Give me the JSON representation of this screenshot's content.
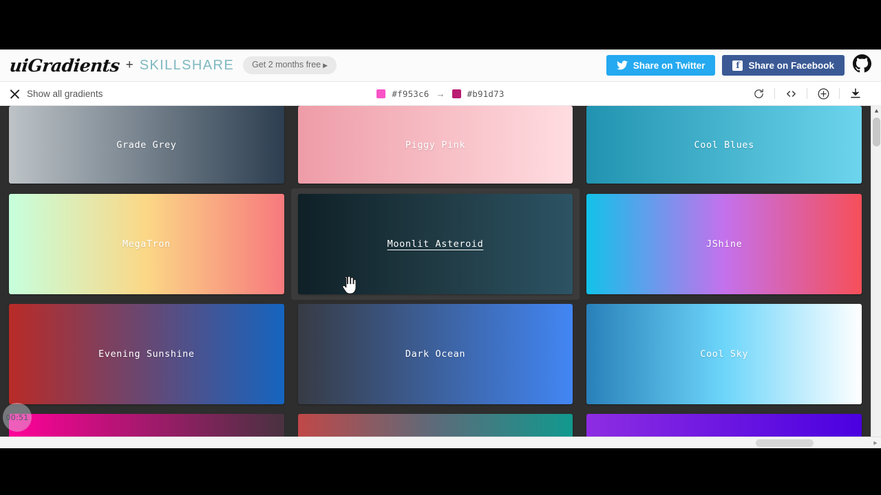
{
  "header": {
    "logo_primary": "uiGradients",
    "logo_plus": "+",
    "logo_partner": "SKILLSHARE",
    "promo_label": "Get 2 months free",
    "promo_caret": "▶",
    "share_twitter_label": "Share on Twitter",
    "share_facebook_label": "Share on Facebook",
    "facebook_glyph": "f",
    "twitter_icon": "twitter-bird-icon",
    "github_icon": "github-octocat-icon",
    "twitter_color": "#25a9f0",
    "facebook_color": "#3b5a95",
    "partner_color": "#7fb8c0"
  },
  "subheader": {
    "show_all_label": "Show all gradients",
    "close_icon": "close-x-icon",
    "color_start": "#f953c6",
    "color_end": "#b91d73",
    "arrow": "→",
    "tools": [
      {
        "name": "refresh-rotate-icon",
        "title": "refresh"
      },
      {
        "name": "code-brackets-icon",
        "title": "code"
      },
      {
        "name": "plus-circle-icon",
        "title": "add"
      },
      {
        "name": "download-icon",
        "title": "download"
      }
    ]
  },
  "grid": {
    "rows": [
      {
        "cells": [
          {
            "label": "Grade Grey",
            "from": "#bdc3c7",
            "to": "#2c3e50",
            "hovered": false
          },
          {
            "label": "Piggy Pink",
            "from": "#ee9ca7",
            "to": "#ffdde1",
            "hovered": false
          },
          {
            "label": "Cool Blues",
            "from": "#2193b0",
            "to": "#6dd5ed",
            "hovered": false
          }
        ]
      },
      {
        "cells": [
          {
            "label": "MegaTron",
            "from": "#c6ffdd",
            "mid": "#fbd786",
            "to": "#f7797d",
            "hovered": false
          },
          {
            "label": "Moonlit Asteroid",
            "from": "#0f2027",
            "mid": "#203a43",
            "to": "#2c5364",
            "hovered": true
          },
          {
            "label": "JShine",
            "from": "#12c2e9",
            "mid": "#c471ed",
            "to": "#f64f59",
            "hovered": false
          }
        ]
      },
      {
        "cells": [
          {
            "label": "Evening Sunshine",
            "from": "#b92b27",
            "to": "#1565c0",
            "hovered": false
          },
          {
            "label": "Dark Ocean",
            "from": "#373b44",
            "to": "#4286f4",
            "hovered": false
          },
          {
            "label": "Cool Sky",
            "from": "#2980b9",
            "mid": "#6dd5fa",
            "to": "#ffffff",
            "hovered": false
          }
        ]
      },
      {
        "cells": [
          {
            "label": "",
            "from": "#ff0099",
            "to": "#493240",
            "hovered": false
          },
          {
            "label": "",
            "from": "#c04848",
            "mid": "#5c6b7a",
            "to": "#11998e",
            "hovered": false
          },
          {
            "label": "",
            "from": "#8e2de2",
            "to": "#4a00e0",
            "hovered": false
          }
        ]
      }
    ]
  },
  "overlay": {
    "recording_timer": "00:51"
  },
  "scrollbars": {
    "vertical_up_arrow": "▲",
    "vertical_down_arrow": "▼",
    "horizontal_right_arrow": "▶"
  }
}
